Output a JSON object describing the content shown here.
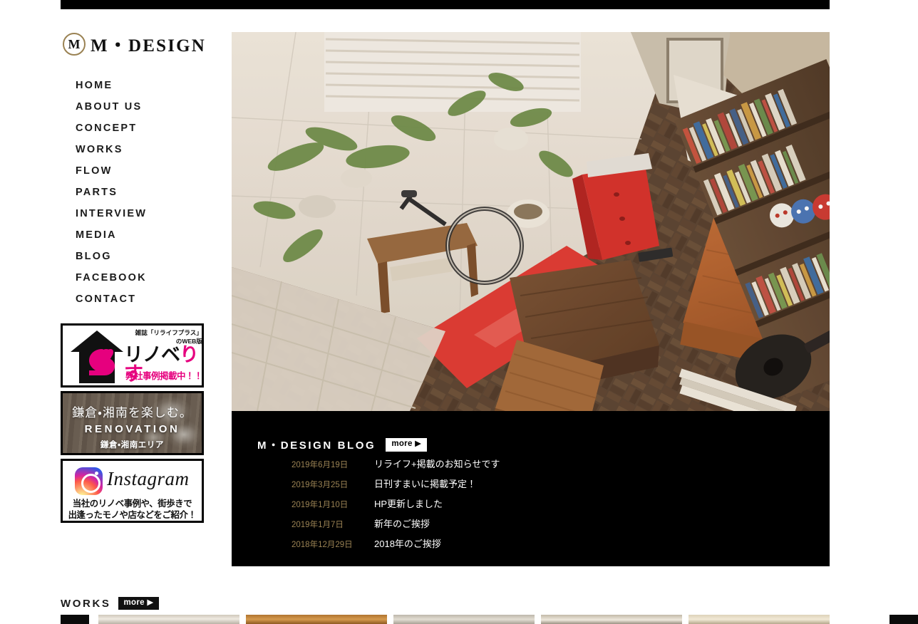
{
  "site": {
    "logo_mark": "M",
    "logo_text": "M・DESIGN"
  },
  "nav": {
    "items": [
      {
        "label": "HOME"
      },
      {
        "label": "ABOUT US"
      },
      {
        "label": "CONCEPT"
      },
      {
        "label": "WORKS"
      },
      {
        "label": "FLOW"
      },
      {
        "label": "PARTS"
      },
      {
        "label": "INTERVIEW"
      },
      {
        "label": "MEDIA"
      },
      {
        "label": "BLOG"
      },
      {
        "label": "FACEBOOK"
      },
      {
        "label": "CONTACT"
      }
    ]
  },
  "banners": {
    "renoberisu": {
      "caption_line1": "雑誌「リライフプラス」",
      "caption_line2": "のWEB版",
      "title_black": "リノベ",
      "title_pink": "りす",
      "subtitle": "弊社事例掲載中！！",
      "icon": "squirrel-house-icon",
      "accent_color": "#e6007e"
    },
    "renovation": {
      "line1": "鎌倉・湘南を楽しむ。",
      "line2": "RENOVATION",
      "line3": "鎌倉・湘南エリア"
    },
    "instagram": {
      "wordmark": "Instagram",
      "icon": "instagram-icon",
      "sub_line1": "当社のリノベ事例や、街歩きで",
      "sub_line2": "出逢ったモノや店などをご紹介！"
    }
  },
  "hero": {
    "alt": "living-room-interior-photo"
  },
  "blog": {
    "title": "M・DESIGN BLOG",
    "more_label": "more ▶",
    "date_color": "#9a8253",
    "entries": [
      {
        "date": "2019年6月19日",
        "title": "リライフ+掲載のお知らせです"
      },
      {
        "date": "2019年3月25日",
        "title": "日刊すまいに掲載予定！"
      },
      {
        "date": "2019年1月10日",
        "title": "HP更新しました"
      },
      {
        "date": "2019年1月7日",
        "title": "新年のご挨拶"
      },
      {
        "date": "2018年12月29日",
        "title": "2018年のご挨拶"
      }
    ]
  },
  "works": {
    "title": "WORKS",
    "more_label": "more ▶",
    "prev_label": "◀",
    "next_label": "▶",
    "thumbnails": [
      {
        "alt": "work-thumbnail-1"
      },
      {
        "alt": "work-thumbnail-2"
      },
      {
        "alt": "work-thumbnail-3"
      },
      {
        "alt": "work-thumbnail-4"
      },
      {
        "alt": "work-thumbnail-5"
      }
    ]
  }
}
